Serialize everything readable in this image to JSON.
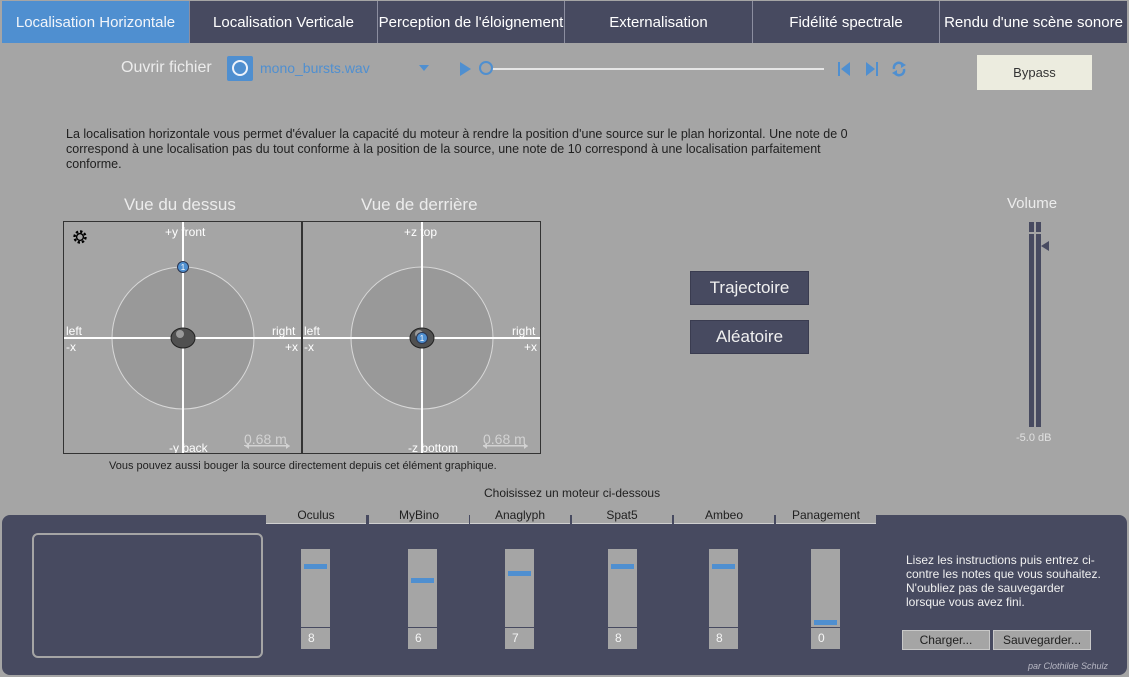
{
  "tabs": [
    {
      "label": "Localisation Horizontale",
      "active": true
    },
    {
      "label": "Localisation Verticale",
      "active": false
    },
    {
      "label": "Perception de l'éloignement",
      "active": false
    },
    {
      "label": "Externalisation",
      "active": false
    },
    {
      "label": "Fidélité spectrale",
      "active": false
    },
    {
      "label": "Rendu d'une scène sonore",
      "active": false
    }
  ],
  "file": {
    "open_label": "Ouvrir fichier",
    "name": "mono_bursts.wav"
  },
  "transport": {
    "position": 0,
    "icons": [
      "play-icon",
      "previous-icon",
      "next-icon",
      "loop-icon"
    ]
  },
  "bypass_label": "Bypass",
  "description": "La localisation horizontale vous permet d'évaluer la capacité du moteur à rendre la position d'une source sur le plan horizontal. Une note de 0 correspond à une localisation pas du tout conforme à la position de la source, une note de 10 correspond à une localisation parfaitement conforme.",
  "views": {
    "top": {
      "title": "Vue du dessus",
      "front": "+y front",
      "back": "-y back",
      "left": "left",
      "left_axis": "-x",
      "right": "right",
      "right_axis": "+x",
      "distance": "0.68 m",
      "source_label": "1"
    },
    "rear": {
      "title": "Vue de derrière",
      "top": "+z top",
      "bottom": "-z bottom",
      "left": "left",
      "left_axis": "-x",
      "right": "right",
      "right_axis": "+x",
      "distance": "0.68 m",
      "source_label": "1"
    },
    "hint": "Vous pouvez aussi bouger la source directement depuis cet élément graphique."
  },
  "actions": {
    "trajectory": "Trajectoire",
    "random": "Aléatoire"
  },
  "volume": {
    "title": "Volume",
    "value": "-5.0 dB"
  },
  "engines": {
    "prompt": "Choisissez un moteur ci-dessous",
    "items": [
      {
        "name": "Oculus",
        "score": "8"
      },
      {
        "name": "MyBino",
        "score": "6"
      },
      {
        "name": "Anaglyph",
        "score": "7"
      },
      {
        "name": "Spat5",
        "score": "8"
      },
      {
        "name": "Ambeo",
        "score": "8"
      },
      {
        "name": "Panagement",
        "score": "0"
      }
    ]
  },
  "instructions": "Lisez les instructions puis entrez ci-contre les notes que vous souhaitez. N'oubliez pas de sauvegarder lorsque vous avez fini.",
  "load_label": "Charger...",
  "save_label": "Sauvegarder...",
  "credit": "par Clothilde Schulz",
  "colors": {
    "accent": "#4f8fd0",
    "panel": "#474a60",
    "background": "#a5a5a5"
  }
}
